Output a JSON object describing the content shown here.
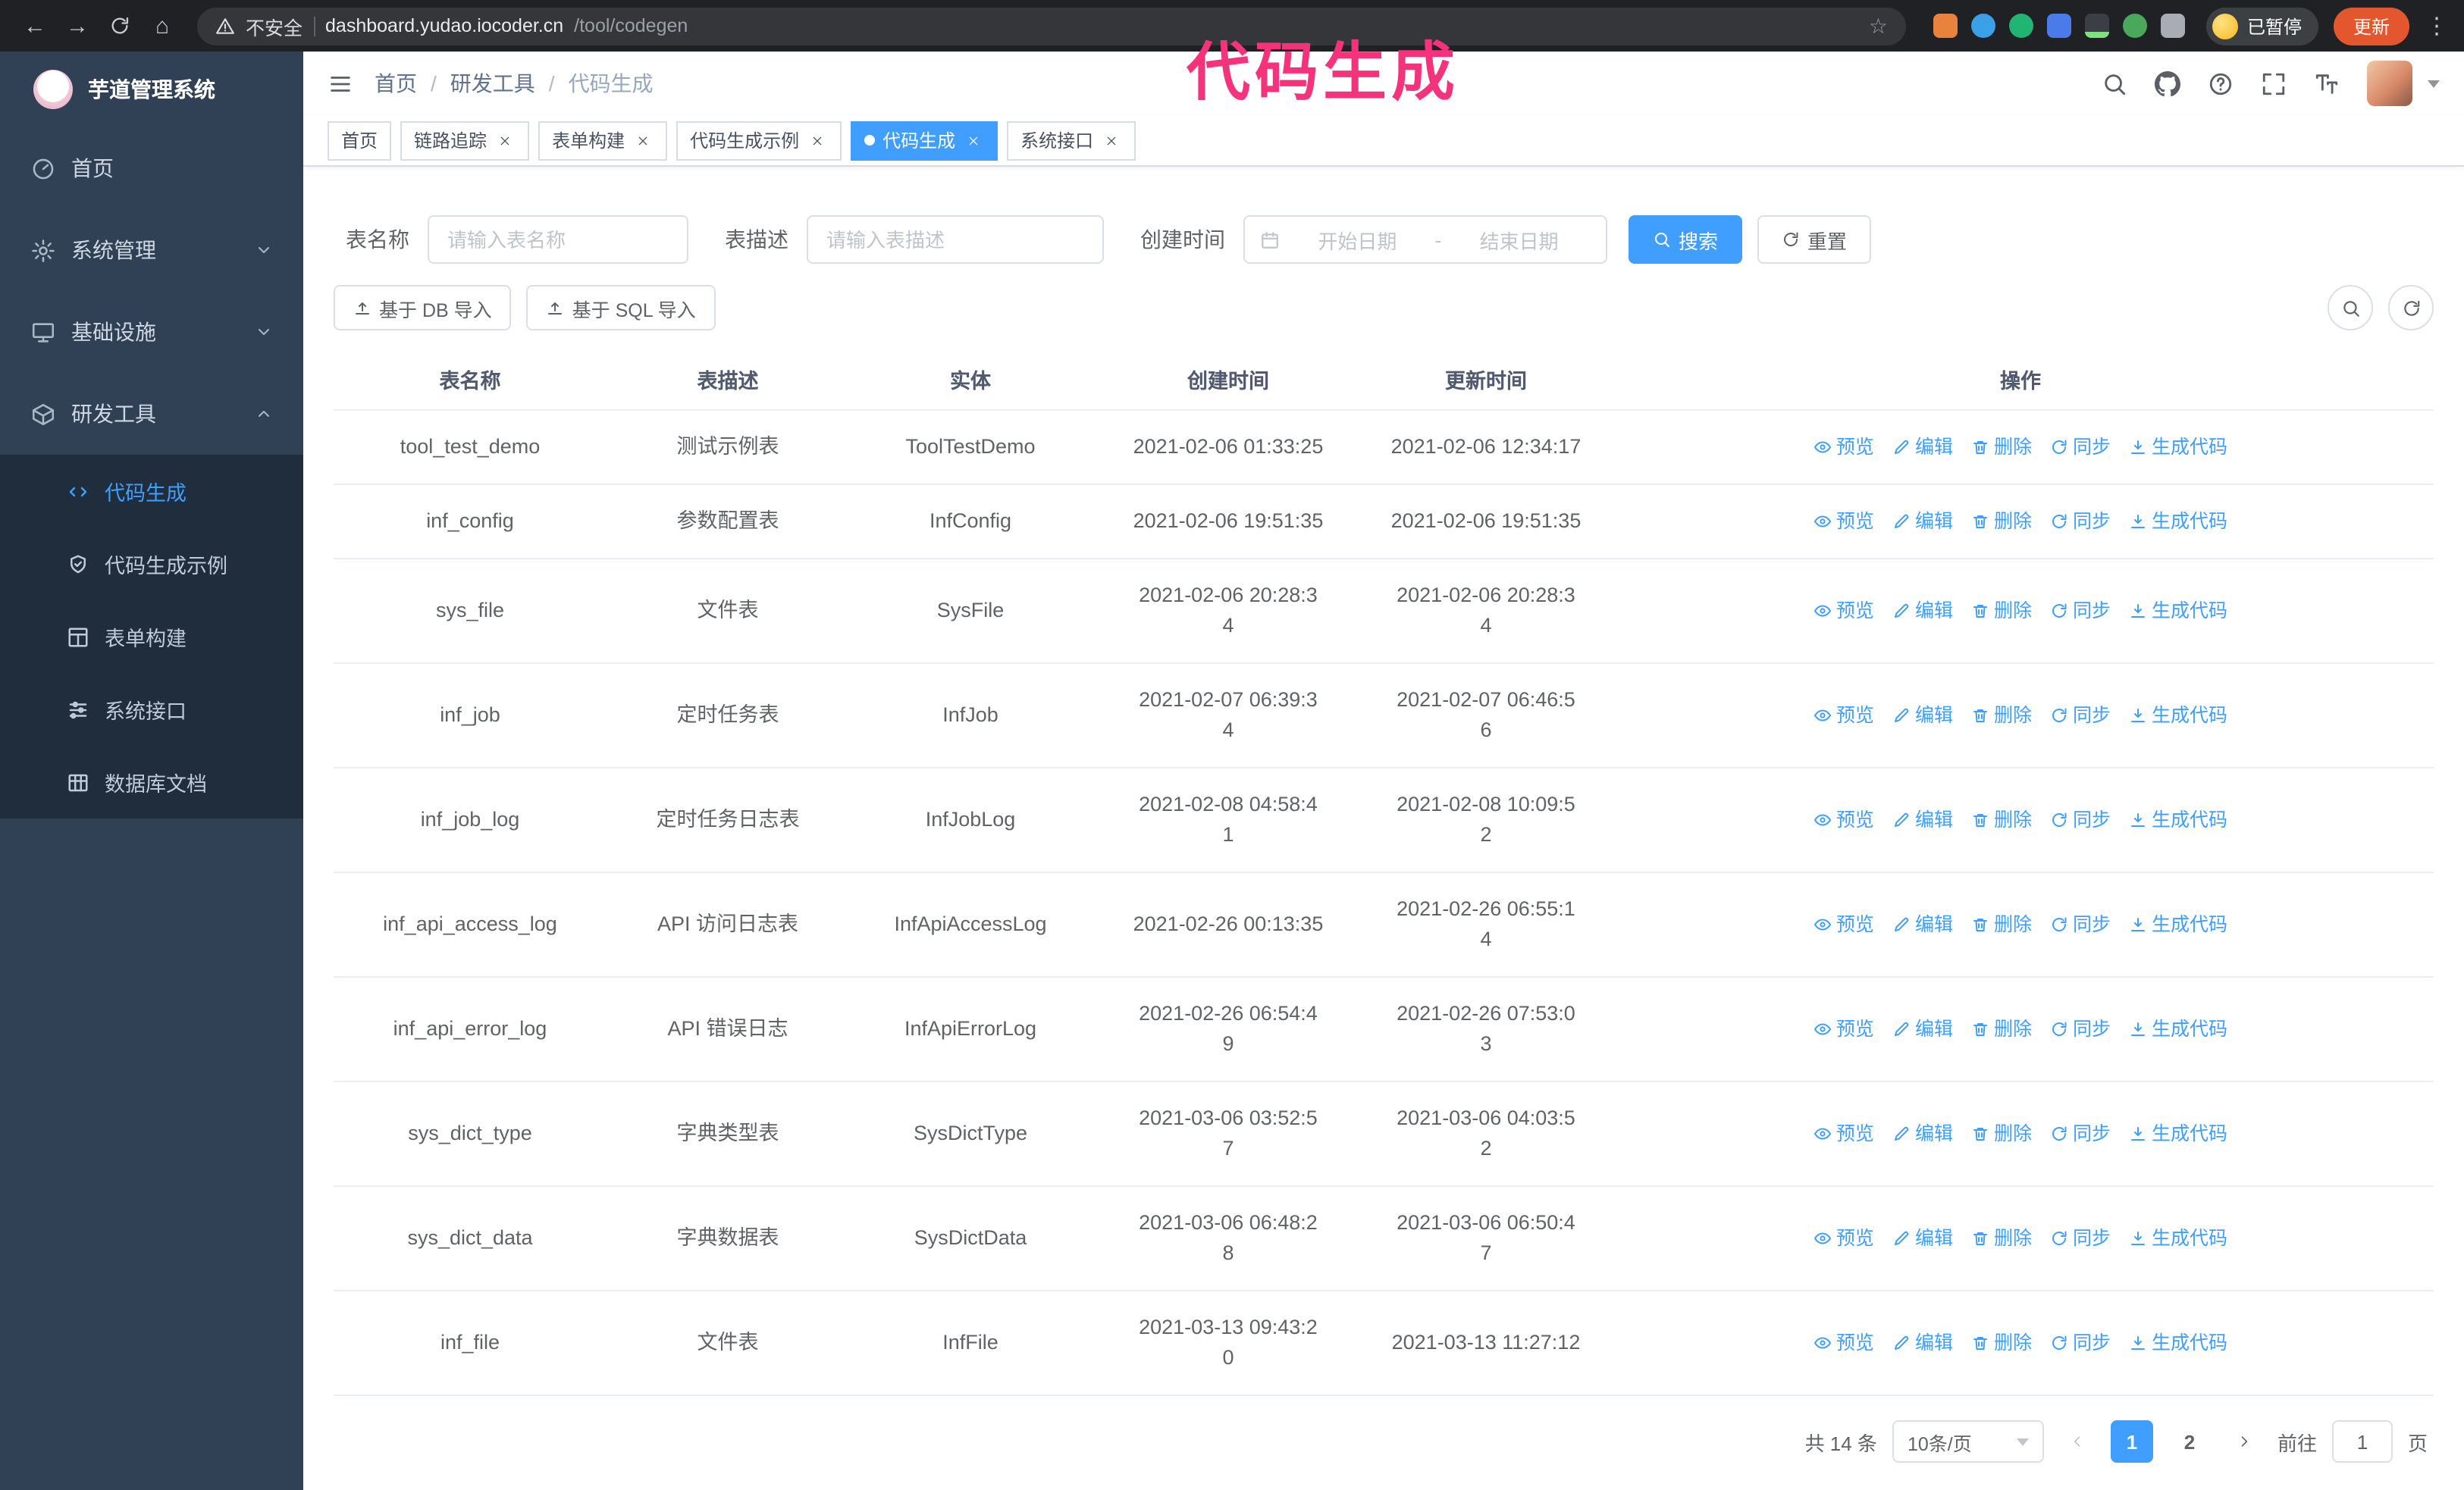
{
  "browser": {
    "security_label": "不安全",
    "url_host": "dashboard.yudao.iocoder.cn",
    "url_path": "/tool/codegen",
    "paused_badge": "已暂停",
    "update_button": "更新"
  },
  "icons": {
    "back": "←",
    "forward": "→",
    "home": "⌂",
    "star": "☆",
    "kebab": "⋮"
  },
  "annotation": {
    "text": "代码生成",
    "color": "#f5337d"
  },
  "colors": {
    "accent_blue": "#409eff",
    "sidebar_bg": "#304156",
    "submenu_bg": "#1f2d3d",
    "annotation_pink": "#f5337d",
    "update_button_orange": "#e4572e"
  },
  "sidebar": {
    "logo_title": "芋道管理系统",
    "items": [
      {
        "label": "首页",
        "icon": "dashboard-icon"
      },
      {
        "label": "系统管理",
        "icon": "gear-icon",
        "chevron": "down"
      },
      {
        "label": "基础设施",
        "icon": "infrastructure-icon",
        "chevron": "down"
      },
      {
        "label": "研发工具",
        "icon": "tools-icon",
        "chevron": "up",
        "expanded": true
      }
    ],
    "submenu": [
      {
        "label": "代码生成",
        "icon": "code-icon",
        "active": true
      },
      {
        "label": "代码生成示例",
        "icon": "shield-check-icon"
      },
      {
        "label": "表单构建",
        "icon": "form-grid-icon"
      },
      {
        "label": "系统接口",
        "icon": "sliders-icon"
      },
      {
        "label": "数据库文档",
        "icon": "table-grid-icon"
      }
    ]
  },
  "header": {
    "breadcrumb": [
      "首页",
      "研发工具",
      "代码生成"
    ],
    "separator": "/"
  },
  "tags": [
    {
      "label": "首页",
      "closable": false,
      "active": false
    },
    {
      "label": "链路追踪",
      "closable": true,
      "active": false
    },
    {
      "label": "表单构建",
      "closable": true,
      "active": false
    },
    {
      "label": "代码生成示例",
      "closable": true,
      "active": false
    },
    {
      "label": "代码生成",
      "closable": true,
      "active": true
    },
    {
      "label": "系统接口",
      "closable": true,
      "active": false
    }
  ],
  "search_form": {
    "table_name_label": "表名称",
    "table_name_placeholder": "请输入表名称",
    "table_desc_label": "表描述",
    "table_desc_placeholder": "请输入表描述",
    "create_time_label": "创建时间",
    "date_start_placeholder": "开始日期",
    "date_separator": "-",
    "date_end_placeholder": "结束日期",
    "search_button": "搜索",
    "reset_button": "重置"
  },
  "toolbar": {
    "import_db_button": "基于 DB 导入",
    "import_sql_button": "基于 SQL 导入"
  },
  "table": {
    "columns": [
      "表名称",
      "表描述",
      "实体",
      "创建时间",
      "更新时间",
      "操作"
    ],
    "actions": [
      "预览",
      "编辑",
      "删除",
      "同步",
      "生成代码"
    ],
    "rows": [
      {
        "name": "tool_test_demo",
        "desc": "测试示例表",
        "entity": "ToolTestDemo",
        "created": [
          "2021-02-06 01:33:25"
        ],
        "updated": [
          "2021-02-06 12:34:17"
        ]
      },
      {
        "name": "inf_config",
        "desc": "参数配置表",
        "entity": "InfConfig",
        "created": [
          "2021-02-06 19:51:35"
        ],
        "updated": [
          "2021-02-06 19:51:35"
        ]
      },
      {
        "name": "sys_file",
        "desc": "文件表",
        "entity": "SysFile",
        "created": [
          "2021-02-06 20:28:3",
          "4"
        ],
        "updated": [
          "2021-02-06 20:28:3",
          "4"
        ]
      },
      {
        "name": "inf_job",
        "desc": "定时任务表",
        "entity": "InfJob",
        "created": [
          "2021-02-07 06:39:3",
          "4"
        ],
        "updated": [
          "2021-02-07 06:46:5",
          "6"
        ]
      },
      {
        "name": "inf_job_log",
        "desc": "定时任务日志表",
        "entity": "InfJobLog",
        "created": [
          "2021-02-08 04:58:4",
          "1"
        ],
        "updated": [
          "2021-02-08 10:09:5",
          "2"
        ]
      },
      {
        "name": "inf_api_access_log",
        "desc": "API 访问日志表",
        "entity": "InfApiAccessLog",
        "created": [
          "2021-02-26 00:13:35"
        ],
        "updated": [
          "2021-02-26 06:55:1",
          "4"
        ]
      },
      {
        "name": "inf_api_error_log",
        "desc": "API 错误日志",
        "entity": "InfApiErrorLog",
        "created": [
          "2021-02-26 06:54:4",
          "9"
        ],
        "updated": [
          "2021-02-26 07:53:0",
          "3"
        ]
      },
      {
        "name": "sys_dict_type",
        "desc": "字典类型表",
        "entity": "SysDictType",
        "created": [
          "2021-03-06 03:52:5",
          "7"
        ],
        "updated": [
          "2021-03-06 04:03:5",
          "2"
        ]
      },
      {
        "name": "sys_dict_data",
        "desc": "字典数据表",
        "entity": "SysDictData",
        "created": [
          "2021-03-06 06:48:2",
          "8"
        ],
        "updated": [
          "2021-03-06 06:50:4",
          "7"
        ]
      },
      {
        "name": "inf_file",
        "desc": "文件表",
        "entity": "InfFile",
        "created": [
          "2021-03-13 09:43:2",
          "0"
        ],
        "updated": [
          "2021-03-13 11:27:12"
        ]
      }
    ]
  },
  "pagination": {
    "total_label": "共 14 条",
    "page_size": "10条/页",
    "pages": [
      "1",
      "2"
    ],
    "active_page": "1",
    "goto_label": "前往",
    "goto_value": "1",
    "goto_unit": "页"
  }
}
